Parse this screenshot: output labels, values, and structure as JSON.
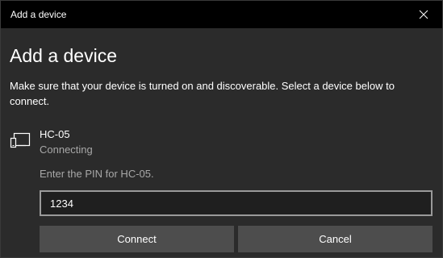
{
  "window": {
    "title": "Add a device",
    "close_icon": "close-icon"
  },
  "main": {
    "heading": "Add a device",
    "description": "Make sure that your device is turned on and discoverable. Select a device below to connect."
  },
  "device": {
    "icon": "device-icon",
    "name": "HC-05",
    "status": "Connecting"
  },
  "pin": {
    "prompt": "Enter the PIN for HC-05.",
    "value": "1234"
  },
  "buttons": {
    "connect_label": "Connect",
    "cancel_label": "Cancel"
  },
  "colors": {
    "background": "#2b2b2b",
    "titlebar": "#000000",
    "secondary_text": "#a8a8a8",
    "button": "#4d4d4d",
    "input_border": "#9a9a9a"
  }
}
